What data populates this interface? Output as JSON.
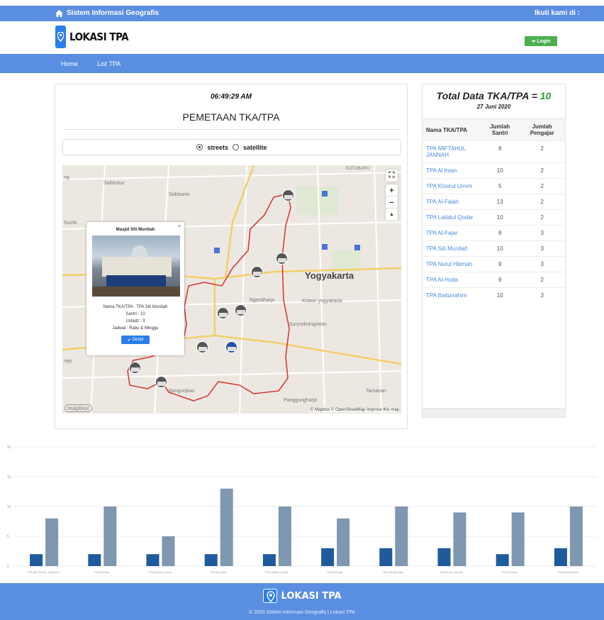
{
  "topbar": {
    "title": "Sistem Informasi Geografis",
    "follow": "Ikuti kami di :"
  },
  "brand": {
    "name": "LOKASI TPA",
    "login": "Login"
  },
  "nav": {
    "items": [
      "Home",
      "List TPA"
    ]
  },
  "map_card": {
    "clock": "06:49:29 AM",
    "title": "PEMETAAN TKA/TPA",
    "layers": [
      "streets",
      "satellite"
    ],
    "selected_layer": "streets",
    "labels": {
      "sidoluhur": "Sidoluhur",
      "sidokarto": "Sidokarto",
      "sumb": "Sumb",
      "yogyakarta": "Yogyakarta",
      "ngestiharjo": "Ngestiharjo",
      "kraton": "Kraton yogyakarta",
      "suryodiningratan": "Suryodiningratan",
      "rejo": "rejo",
      "bangunjiwo": "Bangunjiwo",
      "panggungharjo": "Panggungharjo",
      "tamantan": "Tamanan",
      "kotabaru": "KOTOBARU",
      "ng": "ng"
    },
    "popup": {
      "title": "Masjid Siti Murdiah",
      "lines": [
        "Nama TKA/TPA : TPA Siti Murdiah",
        "Santri : 10",
        "Ustadz : 3",
        "Jadwal : Rabu & Minggu"
      ],
      "button": "Detail"
    },
    "controls": {
      "zoom_in": "+",
      "zoom_out": "−",
      "north": "▲",
      "fullscreen": "⛶"
    },
    "attribution": "© Mapbox © OpenStreetMap  Improve this map",
    "mapbox": "mapbox"
  },
  "table_card": {
    "title_prefix": "Total Data TKA/TPA = ",
    "total": "10",
    "date": "27 Juni 2020",
    "headers": [
      "Nama TKA/TPA",
      "Jumlah Santri",
      "Jumlah Pengajar"
    ],
    "rows": [
      [
        "TPA MIFTAHUL JANNAH",
        "8",
        "2"
      ],
      [
        "TPA Al Iman",
        "10",
        "2"
      ],
      [
        "TPA Khoirul Ummi",
        "5",
        "2"
      ],
      [
        "TPA Al-Falah",
        "13",
        "2"
      ],
      [
        "TPA Lailatul Qodar",
        "10",
        "2"
      ],
      [
        "TPA Al-Fajar",
        "8",
        "3"
      ],
      [
        "TPA Siti Murdiah",
        "10",
        "3"
      ],
      [
        "TPA Nurul Hikmah",
        "9",
        "3"
      ],
      [
        "TPA Al-Huda",
        "9",
        "2"
      ],
      [
        "TPA Baiturrahim",
        "10",
        "3"
      ]
    ]
  },
  "chart_data": {
    "type": "bar",
    "categories": [
      "TPA MIFTAHUL JANNAH",
      "TPA Al Iman",
      "TPA Khoirul Ummi",
      "TPA Al-Falah",
      "TPA Lailatul Qodar",
      "TPA Al-Fajar",
      "TPA Siti Murdiah",
      "TPA Nurul Hikmah",
      "TPA Al-Huda",
      "TPA Baiturrahim"
    ],
    "series": [
      {
        "values": [
          2,
          2,
          2,
          2,
          2,
          3,
          3,
          3,
          2,
          3
        ],
        "color": "#1f5a9c"
      },
      {
        "values": [
          8,
          10,
          5,
          13,
          10,
          8,
          10,
          9,
          9,
          10
        ],
        "color": "#7f97b0"
      }
    ],
    "ylim": [
      0,
      20
    ],
    "yticks": [
      0,
      5,
      10,
      15,
      20
    ],
    "grid": true
  },
  "footer": {
    "brand": "LOKASI TPA",
    "copyright": "© 2020 Sistem Informasi Geografis | Lokasi TPA"
  }
}
